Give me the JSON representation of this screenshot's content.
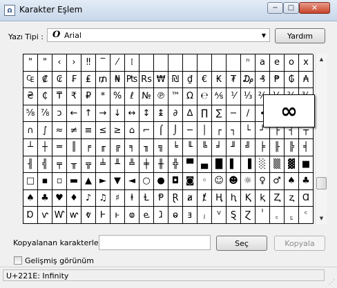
{
  "window": {
    "title": "Karakter Eşlem",
    "app_icon": "charmap-icon",
    "minimize_icon": "−",
    "maximize_icon": "□",
    "close_icon": "✕"
  },
  "font": {
    "label": "Yazı Tipi :",
    "selected": "Arial",
    "font_icon": "O",
    "dropdown_icon": "▼"
  },
  "help_button": "Yardım",
  "grid": {
    "rows": [
      [
        "\"",
        "\"",
        "‹",
        "›",
        "‼",
        "‾",
        "⁄",
        "⁞",
        "",
        "",
        "",
        "",
        "",
        "",
        "",
        "ⁿ",
        "a",
        "e",
        "o",
        "x"
      ],
      [
        "₠",
        "₡",
        "₢",
        "₣",
        "₤",
        "₥",
        "₦",
        "₧",
        "Rs",
        "₩",
        "₪",
        "₫",
        "€",
        "₭",
        "₮",
        "₯",
        "₰",
        "₱",
        "₲",
        "₳"
      ],
      [
        "₴",
        "₵",
        "₸",
        "₹",
        "₽",
        "*",
        "%",
        "ℓ",
        "№",
        "℗",
        "™",
        "Ω",
        "℮",
        "⅍",
        "⅟",
        "⅓",
        "⅔",
        "⅕",
        "⅖",
        "⅗"
      ],
      [
        "⅝",
        "⅞",
        "ↄ",
        "←",
        "↑",
        "→",
        "↓",
        "↔",
        "↕",
        "↨",
        "∂",
        "∆",
        "∏",
        "∑",
        "−",
        "∕",
        "∙",
        "√",
        "∞",
        "∟"
      ],
      [
        "∩",
        "∫",
        "≈",
        "≠",
        "≡",
        "≤",
        "≥",
        "⌂",
        "⌐",
        "⌠",
        "⌡",
        "─",
        "│",
        "┌",
        "┐",
        "└",
        "┘",
        "├",
        "┤",
        "┬"
      ],
      [
        "┴",
        "┼",
        "═",
        "║",
        "╒",
        "╓",
        "╔",
        "╕",
        "╖",
        "╗",
        "╘",
        "╙",
        "╚",
        "╛",
        "╜",
        "╝",
        "╞",
        "╟",
        "╠",
        "╡"
      ],
      [
        "╢",
        "╣",
        "╤",
        "╥",
        "╦",
        "╧",
        "╨",
        "╩",
        "╪",
        "╫",
        "╬",
        "▀",
        "▄",
        "█",
        "▌",
        "▐",
        "░",
        "▒",
        "▓",
        "■"
      ],
      [
        "□",
        "▪",
        "▫",
        "▬",
        "▲",
        "►",
        "▼",
        "◄",
        "○",
        "●",
        "◘",
        "◙",
        "◦",
        "☺",
        "☻",
        "☼",
        "♀",
        "♂",
        "♠",
        "♣"
      ],
      [
        "♠",
        "♣",
        "♥",
        "♦",
        "♪",
        "♫",
        "♯",
        "ⱡ",
        "Ɫ",
        "Ᵽ",
        "Ɽ",
        "ⱥ",
        "ⱦ",
        "Ⱨ",
        "ⱨ",
        "Ⱪ",
        "ⱪ",
        "Ⱬ",
        "ⱬ",
        "Ɑ"
      ],
      [
        "Ɒ",
        "ⱱ",
        "Ⱳ",
        "ⱳ",
        "ⱴ",
        "Ⱶ",
        "ⱶ",
        "ⱷ",
        "ⱸ",
        "ⱹ",
        "ⱺ",
        "ⱻ",
        "ⱼ",
        "ⱽ",
        "Ȿ",
        "Ɀ",
        "ⸯ",
        "꜀",
        "꜁",
        "꜂"
      ]
    ]
  },
  "enlarged_char": "∞",
  "scrollbar": {
    "up_icon": "▲",
    "down_icon": "▼",
    "position": 0.82
  },
  "copy": {
    "label": "Kopyalanan karakterler :",
    "value": "",
    "select_button": "Seç",
    "copy_button": "Kopyala"
  },
  "advanced_view": {
    "label": "Gelişmiş görünüm",
    "checked": false
  },
  "status": "U+221E: Infinity"
}
